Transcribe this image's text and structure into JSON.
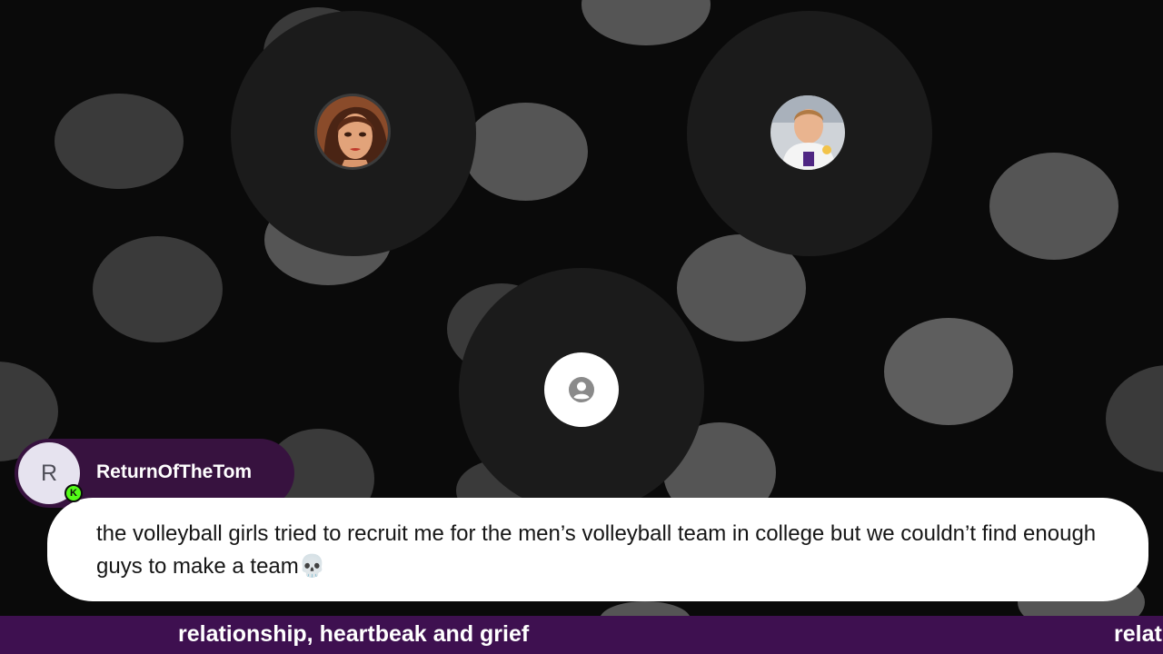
{
  "speakers": [
    {
      "name": "speaker-avatar-woman",
      "icon": "woman-portrait"
    },
    {
      "name": "speaker-avatar-football-player",
      "icon": "football-player-photo"
    },
    {
      "name": "speaker-avatar-placeholder",
      "icon": "user-circle-icon"
    }
  ],
  "chat": {
    "avatar_initial": "R",
    "badge_label": "K",
    "username": "ReturnOfTheTom",
    "message": "the volleyball girls tried to recruit me for the men’s volleyball team in college but we couldn’t find enough guys to make a team💀"
  },
  "ticker": {
    "text": "relationship, heartbeak and grief",
    "text_repeat": "relat"
  },
  "colors": {
    "background": "#0a0a0a",
    "ring": "#1b1b1b",
    "name_pill": "#37123f",
    "ticker_bg": "#3e1050",
    "kick_green": "#53fc18",
    "message_bg": "#ffffff"
  }
}
